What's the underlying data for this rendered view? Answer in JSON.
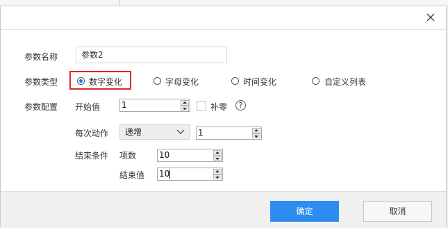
{
  "dialog": {
    "close_icon": "close-icon",
    "param_name": {
      "label": "参数名称",
      "value": "参数2"
    },
    "param_type": {
      "label": "参数类型",
      "options": [
        {
          "label": "数字变化",
          "selected": true
        },
        {
          "label": "字母变化",
          "selected": false
        },
        {
          "label": "时间变化",
          "selected": false
        },
        {
          "label": "自定义列表",
          "selected": false
        }
      ]
    },
    "param_config": {
      "label": "参数配置",
      "start_value": {
        "label": "开始值",
        "value": "1"
      },
      "pad_zero": {
        "label": "补零",
        "checked": false
      },
      "help_icon": "question-circle-icon",
      "help_glyph": "?",
      "each_action": {
        "label": "每次动作",
        "selected": "递增",
        "step": "1"
      },
      "end_condition": {
        "label": "结束条件",
        "count": {
          "label": "项数",
          "value": "10"
        },
        "end_value": {
          "label": "结束值",
          "value": "10"
        }
      }
    },
    "footer": {
      "ok": "确定",
      "cancel": "取消"
    }
  },
  "colors": {
    "primary": "#2d8cf0",
    "highlight": "#e0262c",
    "radio": "#1a73e8"
  }
}
